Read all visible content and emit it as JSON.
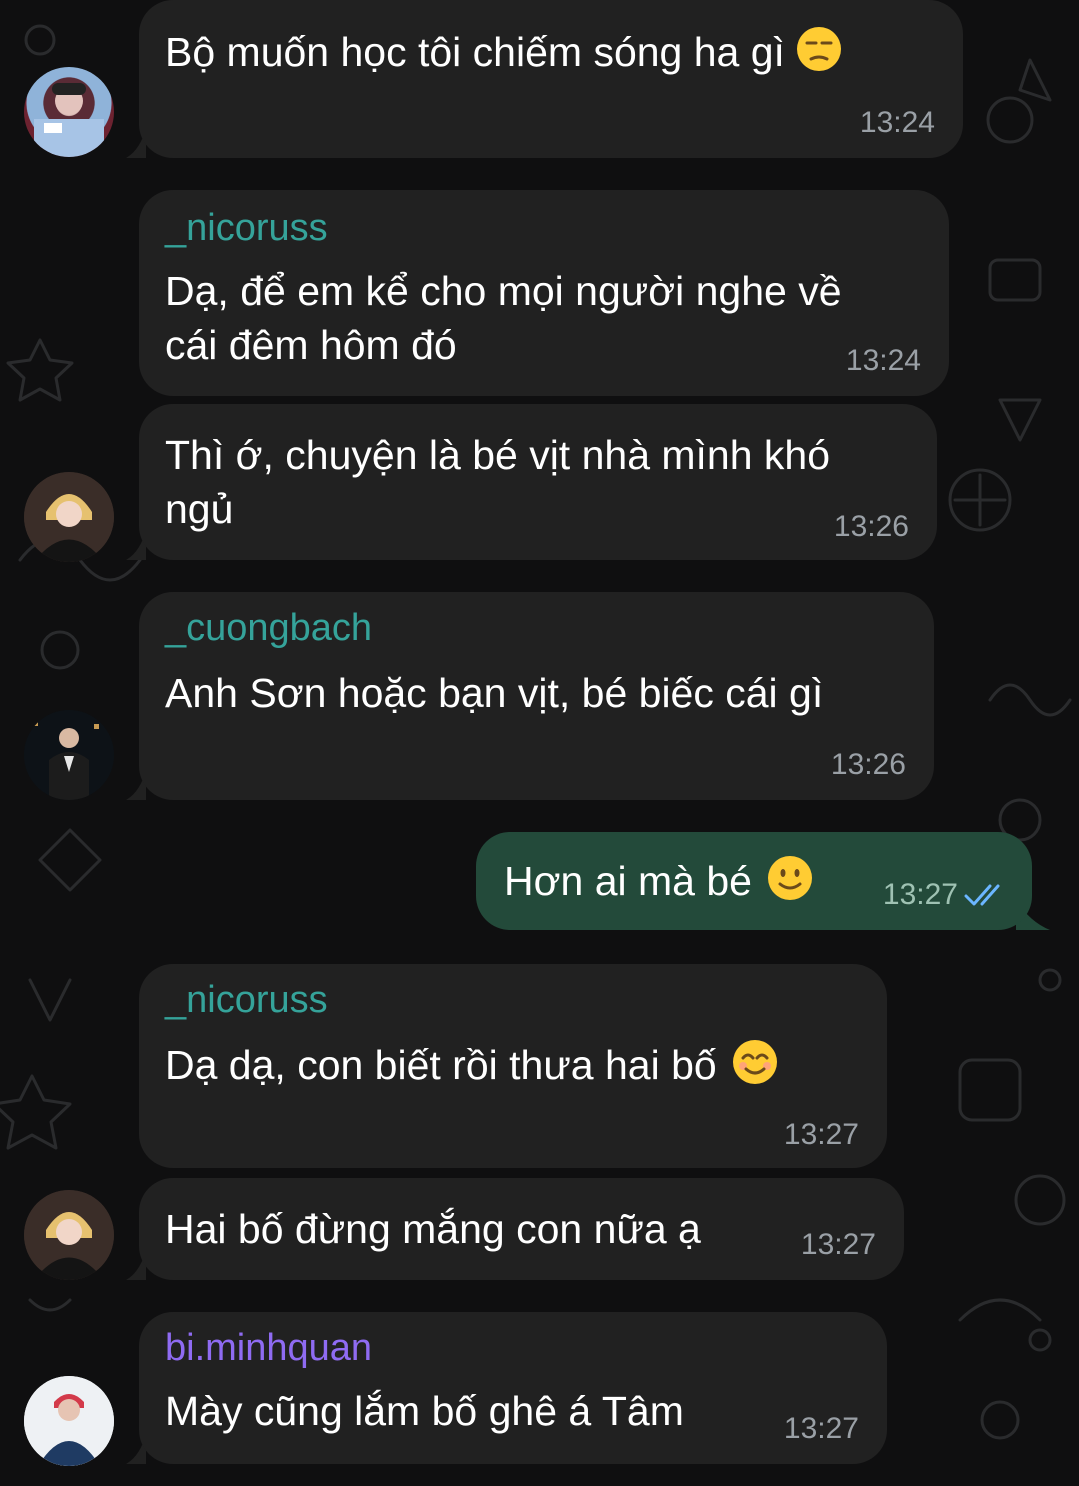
{
  "colors": {
    "background": "#0f0f10",
    "incoming_bubble": "#212121",
    "outgoing_bubble": "#234a3a",
    "sender_nicoruss": "#35a39a",
    "sender_cuongbach": "#35a39a",
    "sender_biminhquan": "#8f6bf2",
    "time": "#9aa0a6",
    "read_ticks": "#6bb6ff"
  },
  "messages": [
    {
      "text": "Bộ muốn học tôi chiếm sóng ha gì",
      "emoji": "unamused-face-icon",
      "time": "13:24"
    },
    {
      "sender": "_nicoruss",
      "lines": [
        "Dạ, để em kể cho mọi người nghe về",
        "cái đêm hôm đó"
      ],
      "time": "13:24"
    },
    {
      "lines": [
        "Thì ớ, chuyện là bé vịt nhà mình khó",
        "ngủ"
      ],
      "time": "13:26"
    },
    {
      "sender": "_cuongbach",
      "text": "Anh Sơn hoặc bạn vịt, bé biếc cái gì",
      "time": "13:26"
    },
    {
      "text": "Hơn ai mà bé",
      "emoji": "slightly-smiling-face-icon",
      "time": "13:27",
      "status": "read-double-check-icon"
    },
    {
      "sender": "_nicoruss",
      "text": "Dạ dạ, con biết rồi thưa hai bố",
      "emoji": "smiling-face-icon",
      "time": "13:27"
    },
    {
      "text": "Hai bố đừng mắng con nữa ạ",
      "time": "13:27"
    },
    {
      "sender": "bi.minhquan",
      "text": "Mày cũng lắm bố ghê á Tâm",
      "time": "13:27"
    }
  ]
}
